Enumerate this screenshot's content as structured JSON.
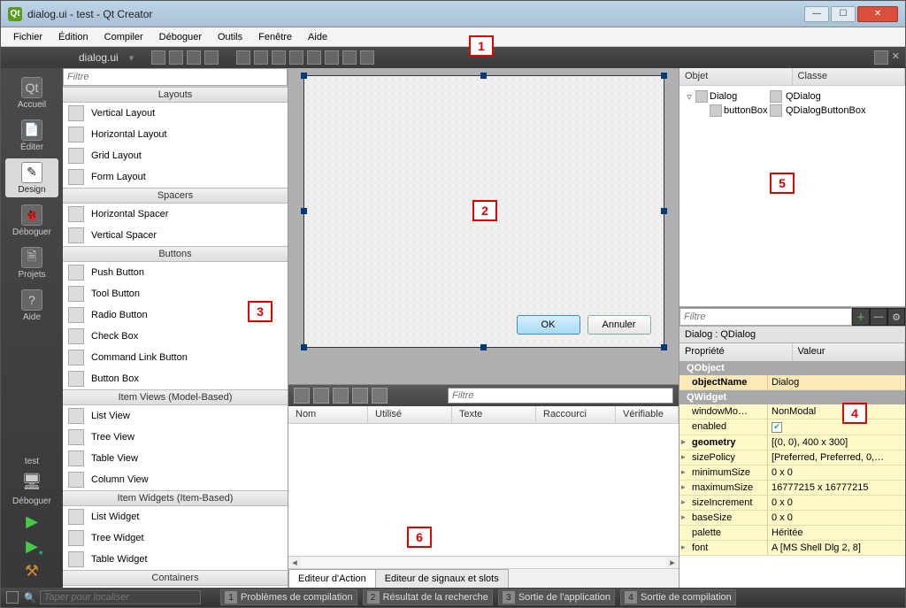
{
  "window": {
    "title": "dialog.ui - test - Qt Creator"
  },
  "menubar": [
    "Fichier",
    "Édition",
    "Compiler",
    "Déboguer",
    "Outils",
    "Fenêtre",
    "Aide"
  ],
  "open_tab": "dialog.ui",
  "annotations": {
    "a1": "1",
    "a2": "2",
    "a3": "3",
    "a4": "4",
    "a5": "5",
    "a6": "6"
  },
  "modes": [
    {
      "label": "Accueil"
    },
    {
      "label": "Éditer"
    },
    {
      "label": "Design"
    },
    {
      "label": "Déboguer"
    },
    {
      "label": "Projets"
    },
    {
      "label": "Aide"
    }
  ],
  "mode_test_label": "test",
  "mode_debug_label": "Déboguer",
  "widgetbox": {
    "filter_placeholder": "Filtre",
    "groups": [
      {
        "name": "Layouts",
        "items": [
          "Vertical Layout",
          "Horizontal Layout",
          "Grid Layout",
          "Form Layout"
        ]
      },
      {
        "name": "Spacers",
        "items": [
          "Horizontal Spacer",
          "Vertical Spacer"
        ]
      },
      {
        "name": "Buttons",
        "items": [
          "Push Button",
          "Tool Button",
          "Radio Button",
          "Check Box",
          "Command Link Button",
          "Button Box"
        ]
      },
      {
        "name": "Item Views (Model-Based)",
        "items": [
          "List View",
          "Tree View",
          "Table View",
          "Column View"
        ]
      },
      {
        "name": "Item Widgets (Item-Based)",
        "items": [
          "List Widget",
          "Tree Widget",
          "Table Widget"
        ]
      },
      {
        "name": "Containers",
        "items": []
      }
    ]
  },
  "canvas": {
    "ok_label": "OK",
    "cancel_label": "Annuler"
  },
  "action_editor": {
    "filter_placeholder": "Filtre",
    "columns": [
      "Nom",
      "Utilisé",
      "Texte",
      "Raccourci",
      "Vérifiable"
    ],
    "tabs": [
      "Editeur d'Action",
      "Editeur de signaux et slots"
    ]
  },
  "obj_inspector": {
    "columns": [
      "Objet",
      "Classe"
    ],
    "rows": [
      {
        "obj": "Dialog",
        "cls": "QDialog",
        "indent": 0,
        "expander": "▿"
      },
      {
        "obj": "buttonBox",
        "cls": "QDialogButtonBox",
        "indent": 1,
        "expander": ""
      }
    ]
  },
  "prop_filter_placeholder": "Filtre",
  "prop_path": "Dialog : QDialog",
  "prop_columns": [
    "Propriété",
    "Valeur"
  ],
  "props": {
    "group1": "QObject",
    "objectName_k": "objectName",
    "objectName_v": "Dialog",
    "group2": "QWidget",
    "windowMod_k": "windowMo…",
    "windowMod_v": "NonModal",
    "enabled_k": "enabled",
    "geometry_k": "geometry",
    "geometry_v": "[(0, 0), 400 x 300]",
    "sizePolicy_k": "sizePolicy",
    "sizePolicy_v": "[Preferred, Preferred, 0,…",
    "minimumSize_k": "minimumSize",
    "minimumSize_v": "0 x 0",
    "maximumSize_k": "maximumSize",
    "maximumSize_v": "16777215 x 16777215",
    "sizeIncrement_k": "sizeIncrement",
    "sizeIncrement_v": "0 x 0",
    "baseSize_k": "baseSize",
    "baseSize_v": "0 x 0",
    "palette_k": "palette",
    "palette_v": "Héritée",
    "font_k": "font",
    "font_v": "A  [MS Shell Dlg 2, 8]"
  },
  "statusbar": {
    "search_placeholder": "Taper pour localiser",
    "tabs": [
      {
        "n": "1",
        "label": "Problèmes de compilation"
      },
      {
        "n": "2",
        "label": "Résultat de la recherche"
      },
      {
        "n": "3",
        "label": "Sortie de l'application"
      },
      {
        "n": "4",
        "label": "Sortie de compilation"
      }
    ]
  }
}
